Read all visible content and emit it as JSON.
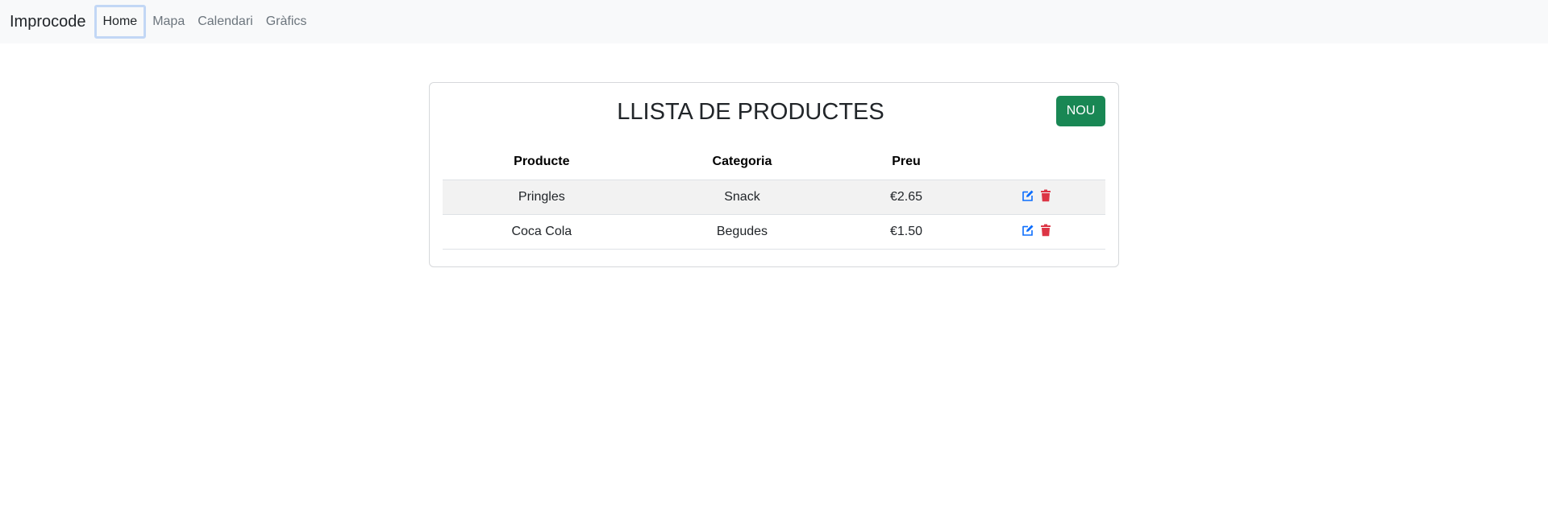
{
  "navbar": {
    "brand": "Improcode",
    "links": [
      {
        "label": "Home",
        "active": true
      },
      {
        "label": "Mapa",
        "active": false
      },
      {
        "label": "Calendari",
        "active": false
      },
      {
        "label": "Gràfics",
        "active": false
      }
    ]
  },
  "card": {
    "title": "LLISTA DE PRODUCTES",
    "new_button_label": "NOU"
  },
  "table": {
    "headers": [
      "Producte",
      "Categoria",
      "Preu",
      ""
    ],
    "rows": [
      {
        "product": "Pringles",
        "category": "Snack",
        "price": "€2.65"
      },
      {
        "product": "Coca Cola",
        "category": "Begudes",
        "price": "€1.50"
      }
    ]
  },
  "icons": {
    "edit": "edit-icon",
    "delete": "trash-icon"
  },
  "colors": {
    "navbar_bg": "#f8f9fa",
    "new_button": "#198754",
    "edit_icon": "#0d6efd",
    "delete_icon": "#dc3545",
    "stripe": "#f2f2f2"
  }
}
